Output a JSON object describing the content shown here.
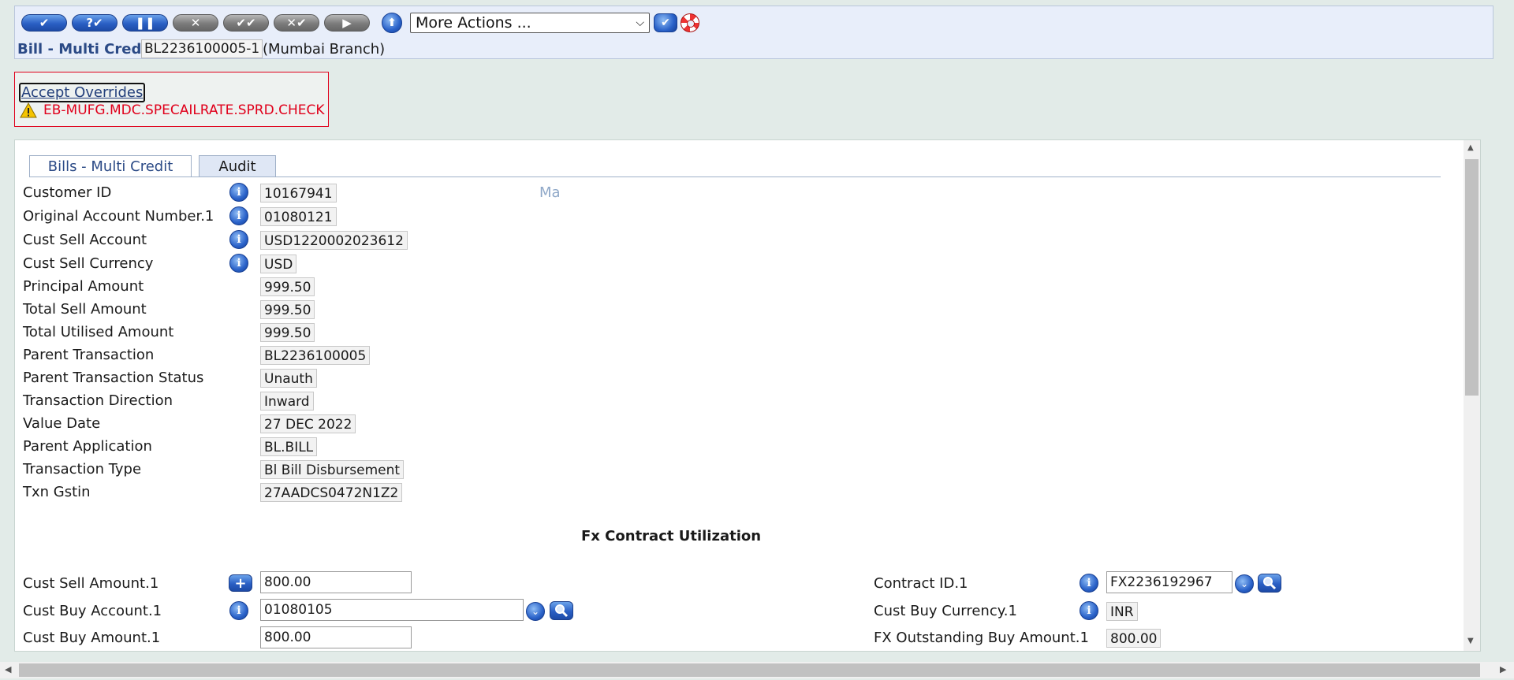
{
  "toolbar": {
    "buttons": [
      {
        "name": "commit",
        "glyph": "✔",
        "style": "blue"
      },
      {
        "name": "validate",
        "glyph": "?✔",
        "style": "blue"
      },
      {
        "name": "hold",
        "glyph": "❚❚",
        "style": "blue"
      },
      {
        "name": "delete",
        "glyph": "✕",
        "style": "grey"
      },
      {
        "name": "authorise",
        "glyph": "✔✔",
        "style": "grey"
      },
      {
        "name": "reverse",
        "glyph": "✕✔",
        "style": "grey"
      },
      {
        "name": "next",
        "glyph": "▶",
        "style": "grey"
      }
    ],
    "more_actions_label": "More Actions ...",
    "icons": {
      "upload": "upload-icon",
      "go": "check-icon",
      "help": "lifebuoy-icon",
      "dropdown": "chevron-down-icon"
    }
  },
  "header": {
    "title": "Bill - Multi Credit",
    "record_id": "BL2236100005-1",
    "branch": "(Mumbai Branch)"
  },
  "overrides": {
    "accept_label": "Accept Overrides",
    "message": "EB-MUFG.MDC.SPECAILRATE.SPRD.CHECK",
    "color": "#e0001b"
  },
  "tabs": [
    "Bills - Multi Credit",
    "Audit"
  ],
  "customer_name_fragment": "Ma",
  "fields": {
    "customer_id": {
      "label": "Customer ID",
      "value": "10167941"
    },
    "orig_account": {
      "label": "Original Account Number.1",
      "value": "01080121"
    },
    "cust_sell_account": {
      "label": "Cust Sell Account",
      "value": "USD1220002023612"
    },
    "cust_sell_currency": {
      "label": "Cust Sell Currency",
      "value": "USD"
    },
    "principal_amount": {
      "label": "Principal Amount",
      "value": "999.50"
    },
    "total_sell_amount": {
      "label": "Total Sell Amount",
      "value": "999.50"
    },
    "total_utilised_amount": {
      "label": "Total Utilised Amount",
      "value": "999.50"
    },
    "parent_transaction": {
      "label": "Parent Transaction",
      "value": "BL2236100005"
    },
    "parent_transaction_status": {
      "label": "Parent Transaction Status",
      "value": "Unauth"
    },
    "transaction_direction": {
      "label": "Transaction Direction",
      "value": "Inward"
    },
    "value_date": {
      "label": "Value Date",
      "value": "27 DEC 2022"
    },
    "parent_application": {
      "label": "Parent Application",
      "value": "BL.BILL"
    },
    "transaction_type": {
      "label": "Transaction Type",
      "value": "Bl Bill Disbursement"
    },
    "txn_gstin": {
      "label": "Txn Gstin",
      "value": "27AADCS0472N1Z2"
    }
  },
  "fx_section": {
    "title": "Fx Contract Utilization",
    "cust_sell_amount": {
      "label": "Cust Sell Amount.1",
      "value": "800.00"
    },
    "cust_buy_account": {
      "label": "Cust Buy Account.1",
      "value": "01080105"
    },
    "cust_buy_amount": {
      "label": "Cust Buy Amount.1",
      "value": "800.00"
    },
    "contract_id": {
      "label": "Contract ID.1",
      "value": "FX2236192967"
    },
    "cust_buy_currency": {
      "label": "Cust Buy Currency.1",
      "value": "INR"
    },
    "fx_outstanding": {
      "label": "FX Outstanding Buy Amount.1",
      "value": "800.00"
    }
  },
  "colors": {
    "accent": "#2b4a86",
    "panel_bg": "#e8eefa",
    "page_bg": "#e2ebe8"
  }
}
